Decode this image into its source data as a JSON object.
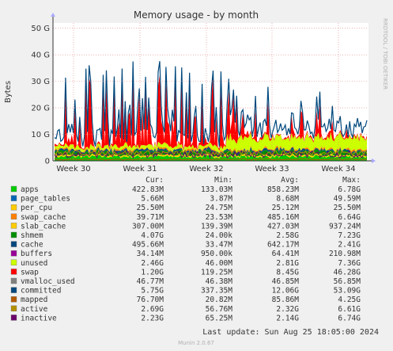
{
  "chart_data": {
    "type": "area",
    "title": "Memory usage - by month",
    "ylabel": "Bytes",
    "xlabel": "",
    "ylim": [
      0,
      52000000000
    ],
    "yticks": [
      {
        "value": 0,
        "label": "0"
      },
      {
        "value": 10000000000,
        "label": "10 G"
      },
      {
        "value": 20000000000,
        "label": "20 G"
      },
      {
        "value": 30000000000,
        "label": "30 G"
      },
      {
        "value": 40000000000,
        "label": "40 G"
      },
      {
        "value": 50000000000,
        "label": "50 G"
      }
    ],
    "xticks": [
      "Week 30",
      "Week 31",
      "Week 32",
      "Week 33",
      "Week 34"
    ],
    "grid": true,
    "legend_columns": [
      "Cur:",
      "Min:",
      "Avg:",
      "Max:"
    ],
    "series": [
      {
        "name": "apps",
        "color": "#00cc00",
        "cur": "422.83M",
        "min": "133.03M",
        "avg": "858.23M",
        "max": "6.78G"
      },
      {
        "name": "page_tables",
        "color": "#0066b3",
        "cur": "5.66M",
        "min": "3.87M",
        "avg": "8.68M",
        "max": "49.59M"
      },
      {
        "name": "per_cpu",
        "color": "#ffcc00",
        "cur": "25.50M",
        "min": "24.75M",
        "avg": "25.12M",
        "max": "25.50M"
      },
      {
        "name": "swap_cache",
        "color": "#ff8000",
        "cur": "39.71M",
        "min": "23.53M",
        "avg": "485.16M",
        "max": "6.64G"
      },
      {
        "name": "slab_cache",
        "color": "#ffcc00",
        "cur": "307.00M",
        "min": "139.39M",
        "avg": "427.03M",
        "max": "937.24M"
      },
      {
        "name": "shmem",
        "color": "#008f00",
        "cur": "4.07G",
        "min": "24.00k",
        "avg": "2.58G",
        "max": "7.23G"
      },
      {
        "name": "cache",
        "color": "#00487d",
        "cur": "495.66M",
        "min": "33.47M",
        "avg": "642.17M",
        "max": "2.41G"
      },
      {
        "name": "buffers",
        "color": "#990099",
        "cur": "34.14M",
        "min": "950.00k",
        "avg": "64.41M",
        "max": "210.98M"
      },
      {
        "name": "unused",
        "color": "#ccff00",
        "cur": "2.46G",
        "min": "46.00M",
        "avg": "2.81G",
        "max": "7.36G"
      },
      {
        "name": "swap",
        "color": "#ff0000",
        "cur": "1.20G",
        "min": "119.25M",
        "avg": "8.45G",
        "max": "46.28G"
      },
      {
        "name": "vmalloc_used",
        "color": "#808080",
        "cur": "46.77M",
        "min": "46.38M",
        "avg": "46.85M",
        "max": "56.85M"
      },
      {
        "name": "committed",
        "color": "#00487d",
        "cur": "5.75G",
        "min": "337.35M",
        "avg": "12.06G",
        "max": "53.09G"
      },
      {
        "name": "mapped",
        "color": "#b35a00",
        "cur": "76.70M",
        "min": "20.82M",
        "avg": "85.86M",
        "max": "4.25G"
      },
      {
        "name": "active",
        "color": "#b38f00",
        "cur": "2.69G",
        "min": "56.76M",
        "avg": "2.32G",
        "max": "6.61G"
      },
      {
        "name": "inactive",
        "color": "#6b006b",
        "cur": "2.23G",
        "min": "65.25M",
        "avg": "2.14G",
        "max": "6.74G"
      }
    ]
  },
  "footer": {
    "last_update": "Last update:  Sun Aug 25 18:05:00 2024",
    "munin": "Munin 2.0.67"
  },
  "watermark": "RRDTOOL / TOBI OETIKER"
}
